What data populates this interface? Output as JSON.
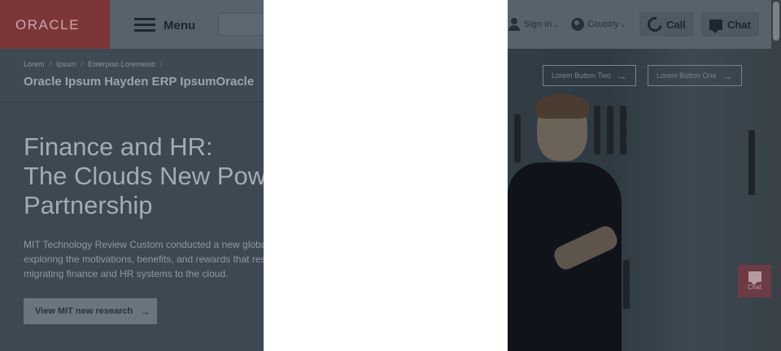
{
  "header": {
    "logo": "ORACLE",
    "menu_label": "Menu",
    "sign_in": "Sign In",
    "country": "Country",
    "call": "Call",
    "chat": "Chat"
  },
  "breadcrumb": [
    "Lorem",
    "Ipsum",
    "Enterpiso Loremesto"
  ],
  "page_title": "Oracle Ipsum Hayden ERP IpsumOracle",
  "actions": {
    "button_two": "Lorem Button Two",
    "button_one": "Lorem Button One"
  },
  "hero": {
    "heading_lines": [
      "Finance and HR:",
      "The Clouds New Power",
      "Partnership"
    ],
    "body_lines": [
      "MIT Technology Review Custom conducted a new global",
      "exploring the motivations, benefits, and rewards that res",
      "migrating finance and HR systems to the cloud."
    ],
    "cta": "View MIT new research"
  },
  "floating_chat": {
    "label": "Chat"
  },
  "colors": {
    "overlay_dim": "#3c4852",
    "brand_red": "#7c3638",
    "modal_bg": "#ffffff"
  }
}
